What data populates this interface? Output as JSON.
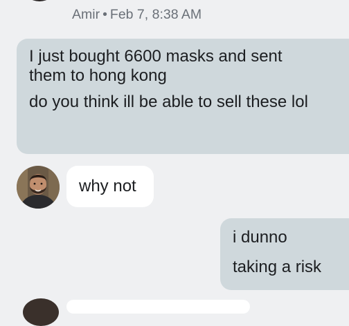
{
  "thread": {
    "meta": {
      "sender": "Amir",
      "separator": "•",
      "timestamp": "Feb 7, 8:38 AM"
    },
    "messages": [
      {
        "author": "self",
        "lines": [
          "I just bought 6600 masks and sent them to hong kong",
          "do you think ill be able to sell these lol"
        ]
      },
      {
        "author": "Amir",
        "lines": [
          "why not"
        ]
      },
      {
        "author": "self",
        "lines": [
          "i dunno",
          "taking a risk"
        ]
      }
    ]
  },
  "colors": {
    "background": "#eff0f2",
    "outgoing_bubble": "#cfd8dc",
    "incoming_bubble": "#ffffff",
    "meta_text": "#6a7078",
    "message_text": "#1c1e21"
  },
  "icons": {
    "avatar": "contact-avatar-photo"
  }
}
